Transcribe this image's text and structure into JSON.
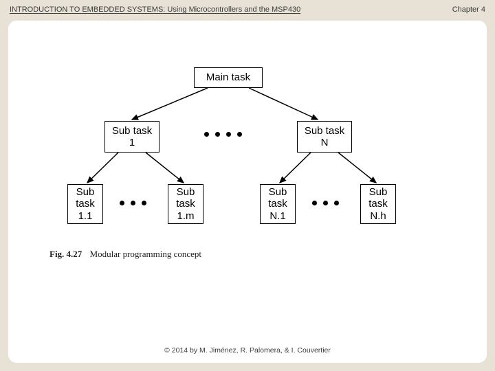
{
  "header": {
    "title": "INTRODUCTION TO EMBEDDED SYSTEMS: Using Microcontrollers and the MSP430",
    "chapter": "Chapter 4"
  },
  "diagram": {
    "nodes": {
      "main": "Main task",
      "sub1": "Sub task\n1",
      "subN": "Sub task\nN",
      "sub11": "Sub\ntask\n1.1",
      "sub1m": "Sub\ntask\n1.m",
      "subN1": "Sub\ntask\nN.1",
      "subNh": "Sub\ntask\nN.h"
    },
    "ellipsis_hint": "…"
  },
  "caption": {
    "fig_number": "Fig. 4.27",
    "text": "Modular programming concept"
  },
  "footer": {
    "copyright": "© 2014 by M. Jiménez, R. Palomera, & I. Couvertier"
  }
}
